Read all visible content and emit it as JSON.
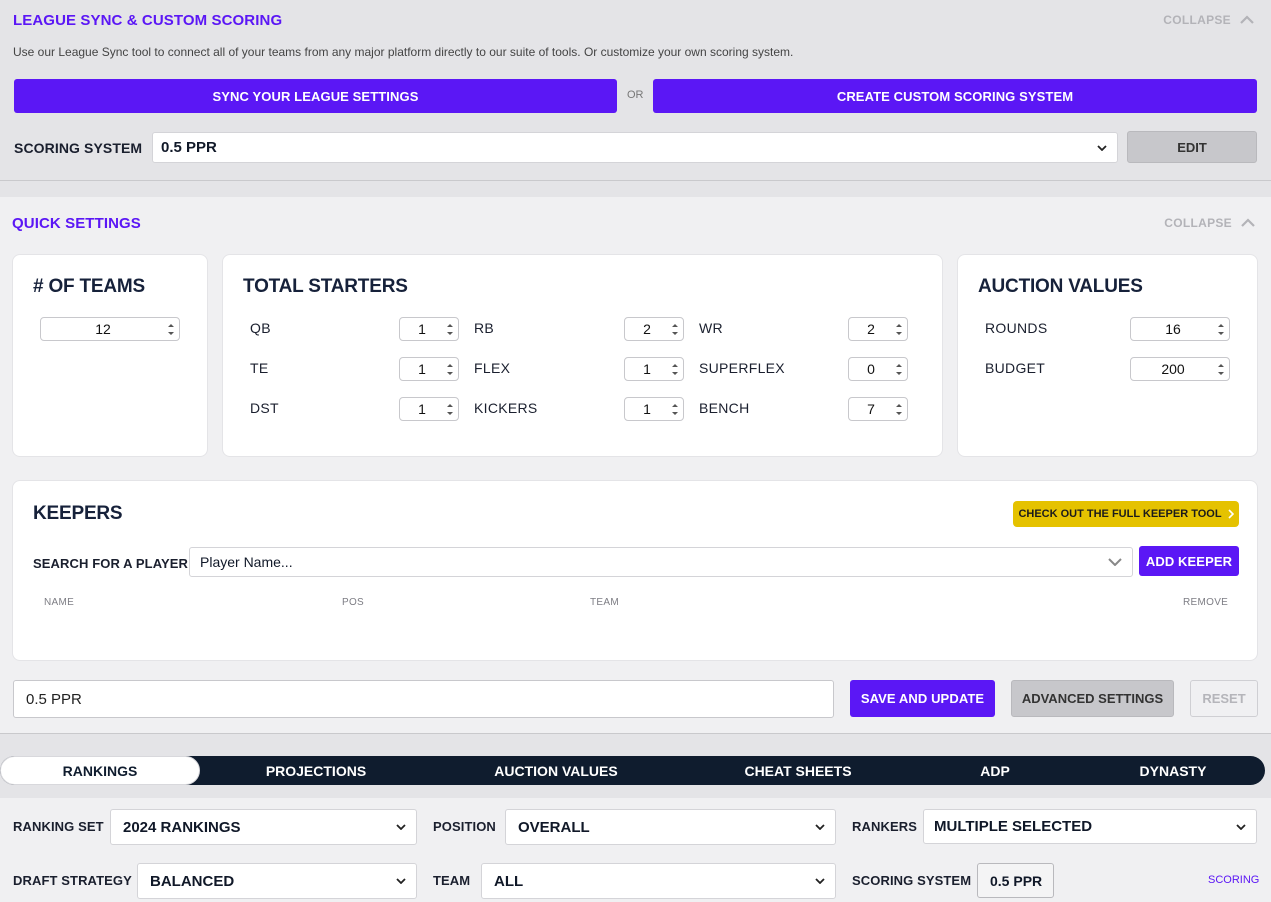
{
  "league_sync": {
    "title": "LEAGUE SYNC & CUSTOM SCORING",
    "collapse_label": "COLLAPSE",
    "description": "Use our League Sync tool to connect all of your teams from any major platform directly to our suite of tools. Or customize your own scoring system.",
    "sync_button": "SYNC YOUR LEAGUE SETTINGS",
    "or_label": "OR",
    "custom_button": "CREATE CUSTOM SCORING SYSTEM",
    "scoring_label": "SCORING SYSTEM",
    "scoring_value": "0.5 PPR",
    "edit_button": "EDIT"
  },
  "quick_settings": {
    "title": "QUICK SETTINGS",
    "collapse_label": "COLLAPSE",
    "teams": {
      "title": "# OF TEAMS",
      "value": "12"
    },
    "starters": {
      "title": "TOTAL STARTERS",
      "fields": [
        {
          "label": "QB",
          "value": "1"
        },
        {
          "label": "RB",
          "value": "2"
        },
        {
          "label": "WR",
          "value": "2"
        },
        {
          "label": "TE",
          "value": "1"
        },
        {
          "label": "FLEX",
          "value": "1"
        },
        {
          "label": "SUPERFLEX",
          "value": "0"
        },
        {
          "label": "DST",
          "value": "1"
        },
        {
          "label": "KICKERS",
          "value": "1"
        },
        {
          "label": "BENCH",
          "value": "7"
        }
      ]
    },
    "auction": {
      "title": "AUCTION VALUES",
      "fields": [
        {
          "label": "ROUNDS",
          "value": "16"
        },
        {
          "label": "BUDGET",
          "value": "200"
        }
      ]
    },
    "keepers": {
      "title": "KEEPERS",
      "full_tool_button": "CHECK OUT THE FULL KEEPER TOOL",
      "search_label": "SEARCH FOR A PLAYER",
      "search_placeholder": "Player Name...",
      "add_button": "ADD KEEPER",
      "columns": [
        "NAME",
        "POS",
        "TEAM",
        "REMOVE"
      ]
    },
    "profile_name": "0.5 PPR",
    "save_button": "SAVE AND UPDATE",
    "advanced_button": "ADVANCED SETTINGS",
    "reset_button": "RESET"
  },
  "tabs": [
    "RANKINGS",
    "PROJECTIONS",
    "AUCTION VALUES",
    "CHEAT SHEETS",
    "ADP",
    "DYNASTY"
  ],
  "filters": {
    "ranking_set_label": "RANKING SET",
    "ranking_set_value": "2024 RANKINGS",
    "position_label": "POSITION",
    "position_value": "OVERALL",
    "rankers_label": "RANKERS",
    "rankers_value": "MULTIPLE SELECTED",
    "draft_strategy_label": "DRAFT STRATEGY",
    "draft_strategy_value": "BALANCED",
    "team_label": "TEAM",
    "team_value": "ALL",
    "scoring_label": "SCORING SYSTEM",
    "scoring_value": "0.5 PPR",
    "scoring_link": "SCORING"
  },
  "colors": {
    "accent": "#5b17f5",
    "tab_bar": "#0f1c2e",
    "keeper_tool": "#e5c200"
  },
  "icons": [
    "chevron-up-icon",
    "chevron-down-icon",
    "stepper-arrows-icon",
    "chevron-right-icon"
  ]
}
